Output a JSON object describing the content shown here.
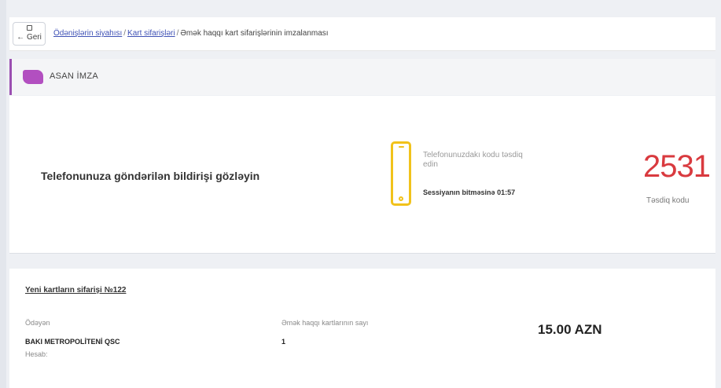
{
  "topbar": {
    "back_label": "Geri",
    "breadcrumb": {
      "link1": "Ödənişlərin siyahısı",
      "link2": "Kart sifarişləri",
      "current": "Əmək haqqı kart sifarişlərinin imzalanması",
      "separator": "/"
    }
  },
  "asan": {
    "label": "ASAN İMZA",
    "brand_color": "#b24fc0"
  },
  "signing": {
    "instruction": "Telefonunuza göndərilən bildirişi gözləyin",
    "phone_hint": "Telefonunuzdakı kodu təsdiq edin",
    "timer_label": "Sessiyanın bitməsinə",
    "timer_value": "01:57",
    "code": "2531",
    "code_label": "Təsdiq kodu",
    "code_color": "#d93a3f",
    "phone_color": "#f1c21b"
  },
  "order": {
    "title": "Yeni kartların sifarişi №122",
    "payer_label": "Ödəyən",
    "payer_name": "BAKI METROPOLİTENİ QSC",
    "account_label": "Hesab:",
    "count_label": "Əmək haqqı kartlarının sayı",
    "count_value": "1",
    "amount": "15.00 AZN"
  }
}
